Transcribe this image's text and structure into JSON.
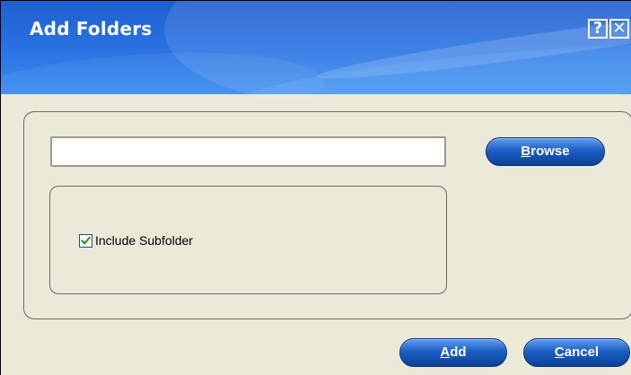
{
  "dialog": {
    "title": "Add Folders",
    "help_label": "?",
    "close_label": "✕"
  },
  "folder_path": {
    "value": "",
    "placeholder": ""
  },
  "options": {
    "include_subfolder": {
      "label": "Include Subfolder",
      "checked": true
    }
  },
  "buttons": {
    "browse": {
      "mnemonic": "B",
      "rest": "rowse"
    },
    "add": {
      "mnemonic": "A",
      "rest": "dd"
    },
    "cancel": {
      "mnemonic": "C",
      "rest": "ancel"
    }
  },
  "colors": {
    "title_bar": "#2a74e3",
    "dialog_background": "#ebe9d8",
    "button": "#1c5fc4",
    "checkmark": "#21a121"
  }
}
